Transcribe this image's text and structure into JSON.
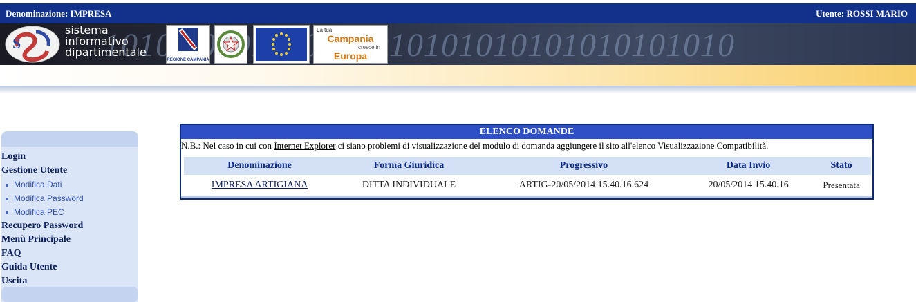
{
  "header": {
    "denominazione": "Denominazione: IMPRESA",
    "utente": "Utente: ROSSI MARIO"
  },
  "banner": {
    "sid_lines": [
      "sistema",
      "informativo",
      "dipartimentale"
    ],
    "binary": "1010 10101010101010101010101010101010",
    "regione_label": "REGIONE CAMPANIA",
    "campania_lines": [
      "La tua",
      "Campania",
      "cresce in",
      "Europa"
    ]
  },
  "sidebar": {
    "items": [
      {
        "label": "Login",
        "type": "main"
      },
      {
        "label": "Gestione Utente",
        "type": "main"
      },
      {
        "label": "Modifica Dati",
        "type": "sub"
      },
      {
        "label": "Modifica Password",
        "type": "sub"
      },
      {
        "label": "Modifica PEC",
        "type": "sub"
      },
      {
        "label": "Recupero Password",
        "type": "main"
      },
      {
        "label": "Menù Principale",
        "type": "main"
      },
      {
        "label": "FAQ",
        "type": "main"
      },
      {
        "label": "Guida Utente",
        "type": "main"
      },
      {
        "label": "Uscita",
        "type": "main"
      }
    ]
  },
  "panel": {
    "title": "ELENCO DOMANDE",
    "note_prefix": "N.B.: Nel caso in cui con ",
    "note_link": "Internet Explorer",
    "note_suffix": " ci siano problemi di visualizzazione del modulo di domanda aggiungere il sito all'elenco Visualizzazione Compatibilità.",
    "columns": [
      "Denominazione",
      "Forma Giuridica",
      "Progressivo",
      "Data Invio",
      "Stato"
    ],
    "rows": [
      [
        "IMPRESA ARTIGIANA",
        "DITTA INDIVIDUALE",
        "ARTIG-20/05/2014 15.40.16.624",
        "20/05/2014 15.40.16",
        "Presentata"
      ]
    ]
  }
}
